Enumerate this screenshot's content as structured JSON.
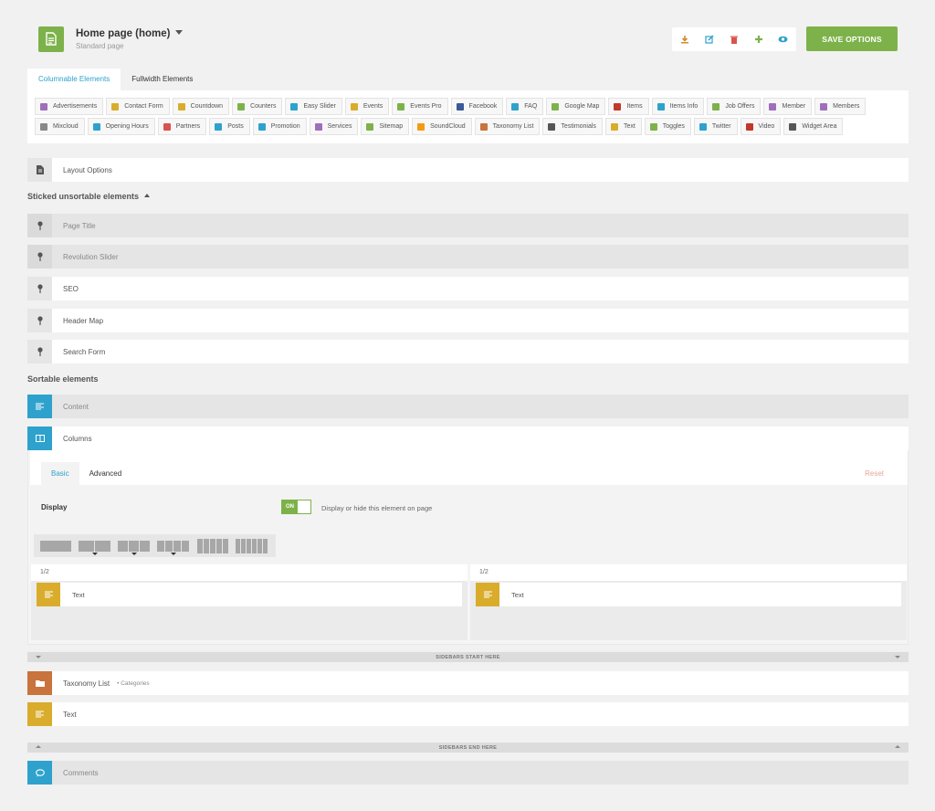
{
  "header": {
    "title": "Home page (home)",
    "subtitle": "Standard page",
    "save_label": "SAVE OPTIONS",
    "icons": [
      "download-icon",
      "edit-icon",
      "trash-icon",
      "plus-icon",
      "eye-icon"
    ]
  },
  "tabs": {
    "columnable": "Columnable Elements",
    "fullwidth": "Fullwidth Elements"
  },
  "palette": [
    {
      "label": "Advertisements",
      "icon": "monitor-icon",
      "color": "#a06dbd"
    },
    {
      "label": "Contact Form",
      "icon": "form-icon",
      "color": "#d9ac2b"
    },
    {
      "label": "Countdown",
      "icon": "undo-icon",
      "color": "#d9ac2b"
    },
    {
      "label": "Counters",
      "icon": "refresh-icon",
      "color": "#7db24a"
    },
    {
      "label": "Easy Slider",
      "icon": "copy-icon",
      "color": "#2ea2cc"
    },
    {
      "label": "Events",
      "icon": "calendar-icon",
      "color": "#d9ac2b"
    },
    {
      "label": "Events Pro",
      "icon": "calendar-check-icon",
      "color": "#7db24a"
    },
    {
      "label": "Facebook",
      "icon": "facebook-icon",
      "color": "#3b5998"
    },
    {
      "label": "FAQ",
      "icon": "question-icon",
      "color": "#2ea2cc"
    },
    {
      "label": "Google Map",
      "icon": "map-pin-icon",
      "color": "#7db24a"
    },
    {
      "label": "Items",
      "icon": "list-icon",
      "color": "#c0392b"
    },
    {
      "label": "Items Info",
      "icon": "info-icon",
      "color": "#2ea2cc"
    },
    {
      "label": "Job Offers",
      "icon": "briefcase-icon",
      "color": "#7db24a"
    },
    {
      "label": "Member",
      "icon": "user-icon",
      "color": "#a06dbd"
    },
    {
      "label": "Members",
      "icon": "users-icon",
      "color": "#a06dbd"
    },
    {
      "label": "Mixcloud",
      "icon": "cloud-icon",
      "color": "#888888"
    },
    {
      "label": "Opening Hours",
      "icon": "clock-icon",
      "color": "#2ea2cc"
    },
    {
      "label": "Partners",
      "icon": "heart-icon",
      "color": "#d9534f"
    },
    {
      "label": "Posts",
      "icon": "posts-icon",
      "color": "#2ea2cc"
    },
    {
      "label": "Promotion",
      "icon": "promotion-icon",
      "color": "#2ea2cc"
    },
    {
      "label": "Services",
      "icon": "gear-icon",
      "color": "#a06dbd"
    },
    {
      "label": "Sitemap",
      "icon": "sitemap-icon",
      "color": "#7db24a"
    },
    {
      "label": "SoundCloud",
      "icon": "soundcloud-icon",
      "color": "#f39c12"
    },
    {
      "label": "Taxonomy List",
      "icon": "folder-icon",
      "color": "#c9733d"
    },
    {
      "label": "Testimonials",
      "icon": "comments-icon",
      "color": "#555555"
    },
    {
      "label": "Text",
      "icon": "text-icon",
      "color": "#d9ac2b"
    },
    {
      "label": "Toggles",
      "icon": "toggle-icon",
      "color": "#7db24a"
    },
    {
      "label": "Twitter",
      "icon": "twitter-icon",
      "color": "#2ea2cc"
    },
    {
      "label": "Video",
      "icon": "video-icon",
      "color": "#c0392b"
    },
    {
      "label": "Widget Area",
      "icon": "widget-icon",
      "color": "#555555"
    }
  ],
  "layout_options": "Layout Options",
  "sticked": {
    "heading": "Sticked unsortable elements",
    "items": [
      "Page Title",
      "Revolution Slider",
      "SEO",
      "Header Map",
      "Search Form"
    ]
  },
  "sortable": {
    "heading": "Sortable elements",
    "content": "Content",
    "columns": "Columns"
  },
  "editor": {
    "tab_basic": "Basic",
    "tab_advanced": "Advanced",
    "reset": "Reset",
    "display_label": "Display",
    "toggle_state": "ON",
    "display_desc": "Display or hide this element on page",
    "col_left": {
      "size": "1/2",
      "item": "Text"
    },
    "col_right": {
      "size": "1/2",
      "item": "Text"
    }
  },
  "sidebars_start": "SIDEBARS START HERE",
  "sidebar_items": {
    "taxonomy": "Taxonomy List",
    "taxonomy_sub": "Categories",
    "text": "Text"
  },
  "sidebars_end": "SIDEBARS END HERE",
  "comments": "Comments",
  "colors": {
    "accent": "#7db24a",
    "blue": "#2ea2cc",
    "text_yellow": "#d9ac2b",
    "taxonomy": "#c9733d"
  }
}
